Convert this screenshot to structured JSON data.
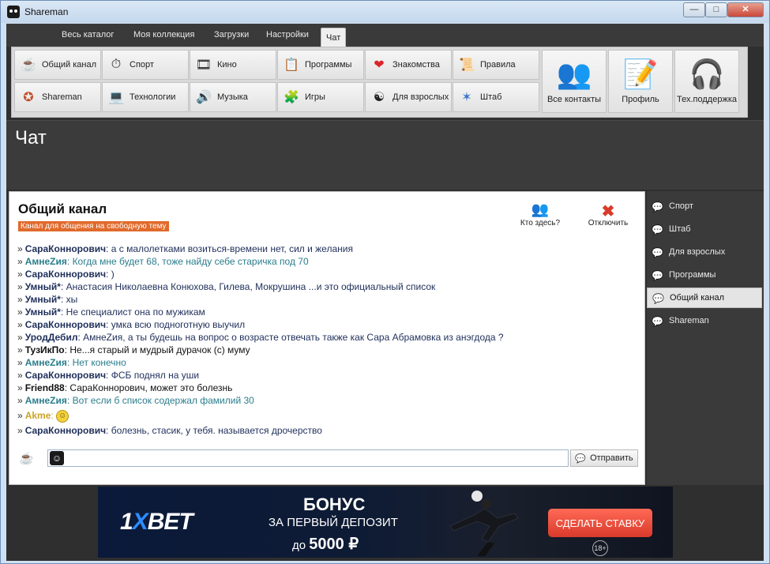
{
  "window": {
    "title": "Shareman"
  },
  "tabs": [
    {
      "label": "Весь каталог"
    },
    {
      "label": "Моя коллекция"
    },
    {
      "label": "Загрузки"
    },
    {
      "label": "Настройки"
    },
    {
      "label": "Чат",
      "active": true
    }
  ],
  "categories": {
    "row1": [
      {
        "label": "Общий канал",
        "icon": "cup-icon"
      },
      {
        "label": "Спорт",
        "icon": "stopwatch-icon"
      },
      {
        "label": "Кино",
        "icon": "film-icon"
      },
      {
        "label": "Программы",
        "icon": "program-icon"
      },
      {
        "label": "Знакомства",
        "icon": "heart-icon"
      },
      {
        "label": "Правила",
        "icon": "scroll-icon"
      }
    ],
    "row2": [
      {
        "label": "Shareman",
        "icon": "network-icon"
      },
      {
        "label": "Технологии",
        "icon": "laptop-icon"
      },
      {
        "label": "Музыка",
        "icon": "speaker-icon"
      },
      {
        "label": "Игры",
        "icon": "puzzle-icon"
      },
      {
        "label": "Для взрослых",
        "icon": "yin-yang-icon"
      },
      {
        "label": "Штаб",
        "icon": "star-icon"
      }
    ],
    "big": [
      {
        "label": "Все контакты",
        "icon": "contacts-icon"
      },
      {
        "label": "Профиль",
        "icon": "profile-icon"
      },
      {
        "label": "Тех.поддержка",
        "icon": "headset-icon"
      }
    ]
  },
  "section": {
    "title": "Чат"
  },
  "chat": {
    "title": "Общий канал",
    "subtitle": "Канал для общения на свободную тему",
    "who_label": "Кто здесь?",
    "disconnect_label": "Отключить",
    "send_label": "Отправить",
    "input_value": "",
    "messages": [
      {
        "nick": "СараКоннорович",
        "sep": ":",
        "text": "а с малолетками возиться-времени нет, сил и желания",
        "color": "dark"
      },
      {
        "nick": "АмнеZия",
        "sep": ":",
        "text": "Когда мне будет 68, тоже найду себе старичка под 70",
        "color": "teal"
      },
      {
        "nick": "СараКоннорович",
        "sep": ":",
        "text": ")",
        "color": "dark"
      },
      {
        "nick": "Умный*",
        "sep": ":",
        "text": "Анастасия Николаевна Конюхова, Гилева, Мокрушина ...и это официальный список",
        "color": "dark"
      },
      {
        "nick": "Умный*",
        "sep": ":",
        "text": "хы",
        "color": "dark"
      },
      {
        "nick": "Умный*",
        "sep": ":",
        "text": "Не специалист она по мужикам",
        "color": "dark"
      },
      {
        "nick": "СараКоннорович",
        "sep": ":",
        "text": "умка всю подноготную выучил",
        "color": "dark"
      },
      {
        "nick": "УродДебил",
        "sep": ":",
        "text": "АмнеZия, а ты будешь на вопрос о возрасте отвечать также как Сара Абрамовка из анэгдода ?",
        "color": "dark"
      },
      {
        "nick": "ТузИкПо",
        "sep": ":",
        "text": "Не...я старый и мудрый дурачок (с) муму",
        "color": "black"
      },
      {
        "nick": "АмнеZия",
        "sep": ":",
        "text": "Нет конечно",
        "color": "teal"
      },
      {
        "nick": "СараКоннорович",
        "sep": ":",
        "text": "ФСБ поднял на уши",
        "color": "dark"
      },
      {
        "nick": "Friend88",
        "sep": ":",
        "text": "СараКоннорович, может это болезнь",
        "color": "black"
      },
      {
        "nick": "АмнеZия",
        "sep": ":",
        "text": "Вот если б список содержал фамилий 30",
        "color": "teal"
      },
      {
        "nick": "Akme",
        "sep": ":",
        "text": "",
        "color": "gold",
        "emoji": "smiley-icon"
      },
      {
        "nick": "СараКоннорович",
        "sep": ":",
        "text": "болезнь, стасик, у тебя. называется дрочерство",
        "color": "dark"
      }
    ]
  },
  "channels": [
    {
      "label": "Спорт"
    },
    {
      "label": "Штаб"
    },
    {
      "label": "Для взрослых"
    },
    {
      "label": "Программы"
    },
    {
      "label": "Общий канал",
      "active": true
    },
    {
      "label": "Shareman"
    }
  ],
  "ad": {
    "logo_prefix": "1",
    "logo_x": "X",
    "logo_rest": "BET",
    "headline": "БОНУС",
    "line2": "ЗА ПЕРВЫЙ ДЕПОЗИТ",
    "line3_prefix": "до",
    "line3_amount": "5000 ₽",
    "cta": "СДЕЛАТЬ СТАВКУ",
    "age": "18+"
  },
  "colors": {
    "accent": "#e06a2c",
    "nick_dark": "#1f2f5a",
    "nick_teal": "#2a7d8c"
  }
}
